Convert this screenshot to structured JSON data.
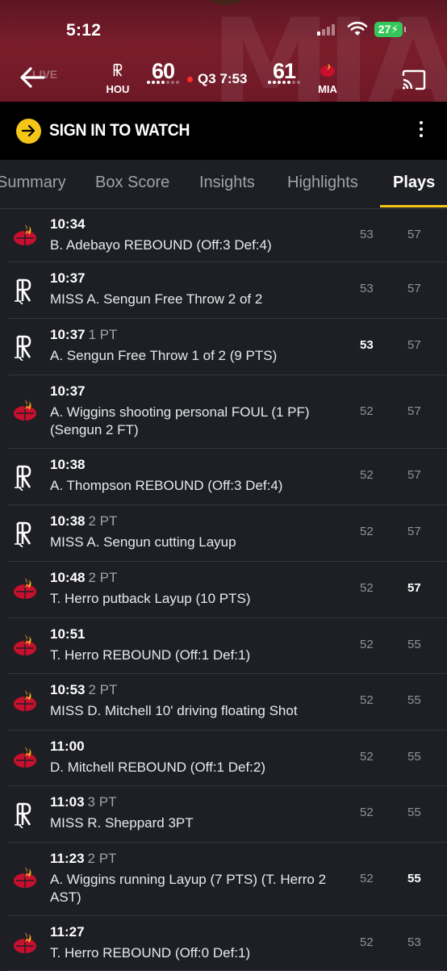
{
  "status_bar": {
    "time": "5:12",
    "battery": "27"
  },
  "header": {
    "live_label": "LIVE",
    "away": {
      "abbr": "HOU",
      "score": "60"
    },
    "home": {
      "abbr": "MIA",
      "score": "61"
    },
    "clock": "Q3 7:53",
    "colors": {
      "background": "#7a1d2b",
      "live_dot": "#ff2d2d"
    }
  },
  "signin": {
    "label": "SIGN IN TO WATCH",
    "accent": "#f5c518"
  },
  "tabs": [
    {
      "label": "Summary"
    },
    {
      "label": "Box Score"
    },
    {
      "label": "Insights"
    },
    {
      "label": "Highlights"
    },
    {
      "label": "Plays"
    }
  ],
  "plays": [
    {
      "team": "MIA",
      "time": "10:34",
      "pt": "",
      "desc": "B. Adebayo REBOUND (Off:3 Def:4)",
      "hou": "53",
      "mia": "57",
      "hi": ""
    },
    {
      "team": "HOU",
      "time": "10:37",
      "pt": "",
      "desc": "MISS A. Sengun Free Throw 2 of 2",
      "hou": "53",
      "mia": "57",
      "hi": ""
    },
    {
      "team": "HOU",
      "time": "10:37",
      "pt": "1 PT",
      "desc": "A. Sengun Free Throw 1 of 2 (9 PTS)",
      "hou": "53",
      "mia": "57",
      "hi": "hou"
    },
    {
      "team": "MIA",
      "time": "10:37",
      "pt": "",
      "desc": "A. Wiggins shooting personal FOUL (1 PF) (Sengun 2 FT)",
      "hou": "52",
      "mia": "57",
      "hi": ""
    },
    {
      "team": "HOU",
      "time": "10:38",
      "pt": "",
      "desc": "A. Thompson REBOUND (Off:3 Def:4)",
      "hou": "52",
      "mia": "57",
      "hi": ""
    },
    {
      "team": "HOU",
      "time": "10:38",
      "pt": "2 PT",
      "desc": "MISS A. Sengun cutting Layup",
      "hou": "52",
      "mia": "57",
      "hi": ""
    },
    {
      "team": "MIA",
      "time": "10:48",
      "pt": "2 PT",
      "desc": "T. Herro putback Layup (10 PTS)",
      "hou": "52",
      "mia": "57",
      "hi": "mia"
    },
    {
      "team": "MIA",
      "time": "10:51",
      "pt": "",
      "desc": "T. Herro REBOUND (Off:1 Def:1)",
      "hou": "52",
      "mia": "55",
      "hi": ""
    },
    {
      "team": "MIA",
      "time": "10:53",
      "pt": "2 PT",
      "desc": "MISS D. Mitchell 10' driving floating Shot",
      "hou": "52",
      "mia": "55",
      "hi": ""
    },
    {
      "team": "MIA",
      "time": "11:00",
      "pt": "",
      "desc": "D. Mitchell REBOUND (Off:1 Def:2)",
      "hou": "52",
      "mia": "55",
      "hi": ""
    },
    {
      "team": "HOU",
      "time": "11:03",
      "pt": "3 PT",
      "desc": "MISS R. Sheppard 3PT",
      "hou": "52",
      "mia": "55",
      "hi": ""
    },
    {
      "team": "MIA",
      "time": "11:23",
      "pt": "2 PT",
      "desc": "A. Wiggins running Layup (7 PTS) (T. Herro 2 AST)",
      "hou": "52",
      "mia": "55",
      "hi": "mia"
    },
    {
      "team": "MIA",
      "time": "11:27",
      "pt": "",
      "desc": "T. Herro REBOUND (Off:0 Def:1)",
      "hou": "52",
      "mia": "53",
      "hi": ""
    }
  ]
}
